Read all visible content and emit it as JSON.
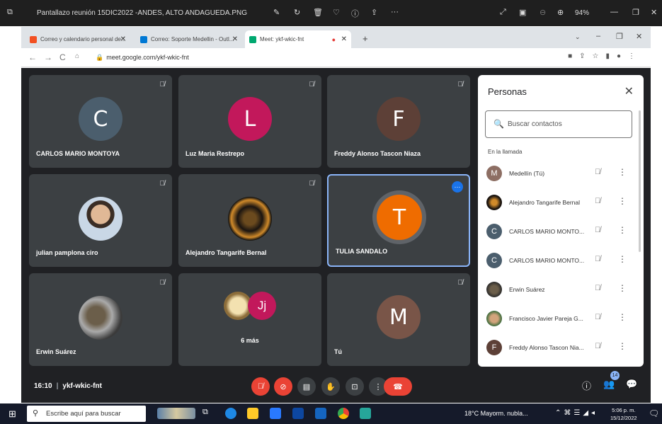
{
  "viewer": {
    "title": "Pantallazo reunión 15DIC2022 -ANDES, ALTO ANDAGUEDA.PNG",
    "zoom": "94%"
  },
  "tabs": [
    {
      "label": "Correo y calendario personal de...",
      "color": "#f25022"
    },
    {
      "label": "Correo: Soporte Medellin - Outl...",
      "color": "#0078d4"
    },
    {
      "label": "Meet: ykf-wkic-fnt",
      "color": "#00a870"
    }
  ],
  "address": {
    "url": "meet.google.com/ykf-wkic-fnt"
  },
  "tiles": [
    {
      "name": "CARLOS MARIO MONTOYA",
      "initial": "C",
      "color": "#4b5e6d",
      "type": "initial"
    },
    {
      "name": "Luz Maria Restrepo",
      "initial": "L",
      "color": "#c2185b",
      "type": "initial"
    },
    {
      "name": "Freddy Alonso Tascon Niaza",
      "initial": "F",
      "color": "#5d4037",
      "type": "initial"
    },
    {
      "name": "julian pamplona ciro",
      "initial": "",
      "color": "#c6a58a",
      "type": "photo"
    },
    {
      "name": "Alejandro Tangarife Bernal",
      "initial": "",
      "color": "#1a1a1a",
      "type": "photo"
    },
    {
      "name": "TULIA SANDALO",
      "initial": "T",
      "color": "#ef6c00",
      "type": "initial"
    },
    {
      "name": "Erwin Suárez",
      "initial": "",
      "color": "#5a5a5a",
      "type": "photo"
    },
    {
      "name": "6 más",
      "initial": "Jj",
      "color": "#c2185b",
      "type": "more"
    },
    {
      "name": "Tú",
      "initial": "M",
      "color": "#795548",
      "type": "initial"
    }
  ],
  "people": {
    "title": "Personas",
    "search_placeholder": "Buscar contactos",
    "section": "En la llamada",
    "list": [
      {
        "name": "Medellín (Tú)",
        "initial": "M",
        "color": "#8d6e63"
      },
      {
        "name": "Alejandro Tangarife Bernal",
        "initial": "",
        "color": "#3a2a14"
      },
      {
        "name": "CARLOS MARIO MONTO...",
        "initial": "C",
        "color": "#4b5e6d"
      },
      {
        "name": "CARLOS MARIO MONTO...",
        "initial": "C",
        "color": "#4b5e6d"
      },
      {
        "name": "Erwin Suárez",
        "initial": "",
        "color": "#6b5e4a"
      },
      {
        "name": "Francisco Javier Pareja G...",
        "initial": "",
        "color": "#a87e5a"
      },
      {
        "name": "Freddy Alonso Tascon Nia...",
        "initial": "F",
        "color": "#5d4037"
      }
    ]
  },
  "bottom": {
    "time": "16:10",
    "code": "ykf-wkic-fnt",
    "participant_count": "14"
  },
  "taskbar": {
    "search": "Escribe aquí para buscar",
    "weather": "18°C  Mayorm. nubla...",
    "time": "5:06 p. m.",
    "date": "15/12/2022"
  }
}
